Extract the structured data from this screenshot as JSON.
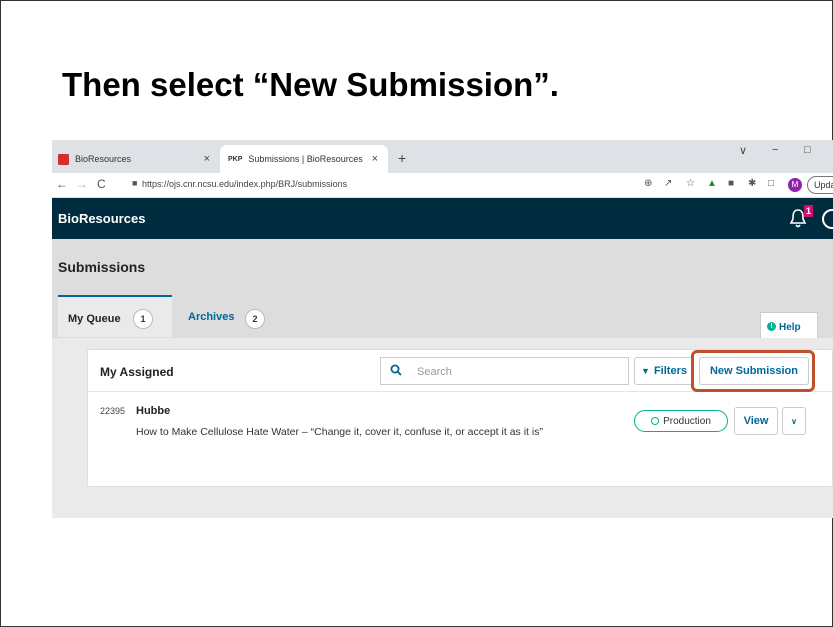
{
  "slide": {
    "title": "Then select “New Submission”."
  },
  "browser": {
    "tabs": [
      {
        "label": "BioResources",
        "favicon": "bioresources-favicon"
      },
      {
        "label": "Submissions | BioResources",
        "favicon_text": "PKP"
      }
    ],
    "tab_close": "×",
    "new_tab": "+",
    "window_controls": {
      "menu": "∨",
      "minimize": "−",
      "maximize": "□"
    },
    "url": "https://ojs.cnr.ncsu.edu/index.php/BRJ/submissions",
    "profile_initial": "M",
    "update_label": "Update"
  },
  "app": {
    "name": "BioResources",
    "notification_count": "1"
  },
  "page": {
    "title": "Submissions",
    "tabs": [
      {
        "label": "My Queue",
        "count": "1"
      },
      {
        "label": "Archives",
        "count": "2"
      }
    ],
    "help_label": "Help",
    "panel": {
      "title": "My Assigned",
      "search_placeholder": "Search",
      "filters_label": "Filters",
      "new_submission_label": "New Submission",
      "rows": [
        {
          "id": "22395",
          "author": "Hubbe",
          "title": "How to Make Cellulose Hate Water – “Change it, cover it, confuse it, or accept it as it is”",
          "stage": "Production",
          "view_label": "View"
        }
      ]
    }
  },
  "colors": {
    "header": "#002c40",
    "accent": "#006798",
    "badge": "#d0106f",
    "highlight": "#c0502a",
    "stage": "#00b28d"
  }
}
